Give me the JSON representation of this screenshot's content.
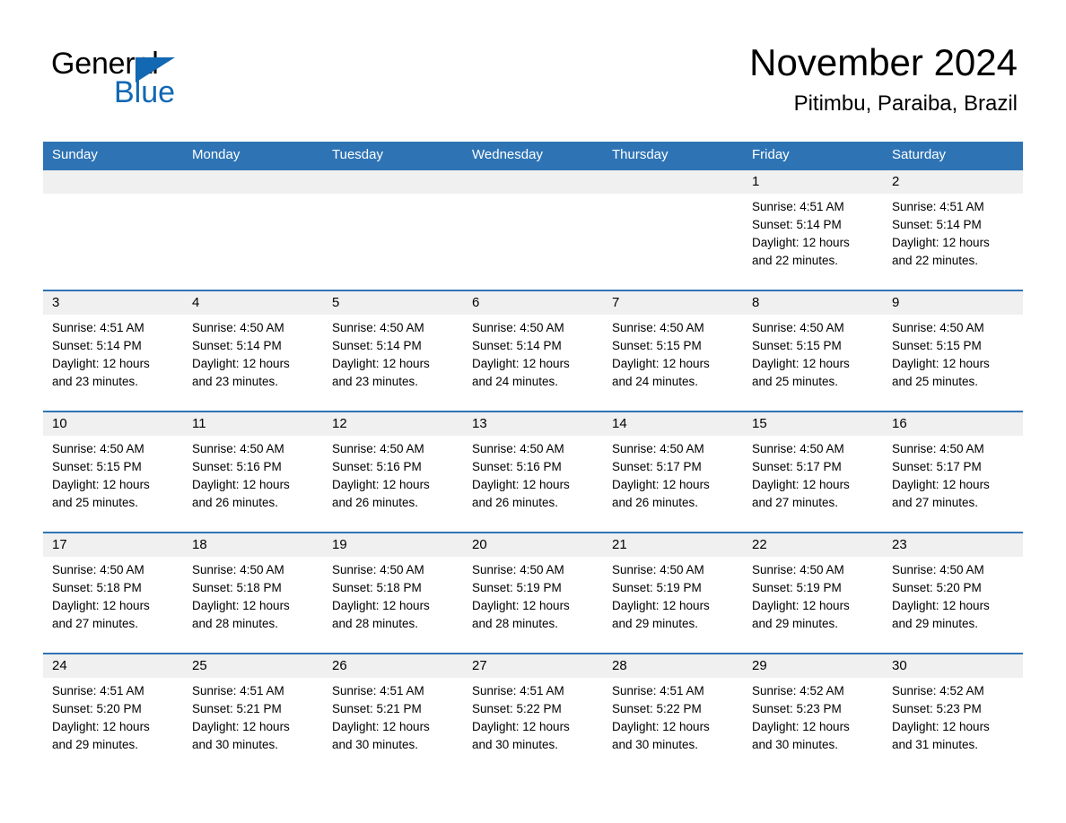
{
  "brand": {
    "name_part1": "General",
    "name_part2": "Blue",
    "accent_color": "#1268b3"
  },
  "header": {
    "month_title": "November 2024",
    "location": "Pitimbu, Paraiba, Brazil",
    "header_bar_color": "#2e74b5",
    "daynum_band_color": "#f0f0f0"
  },
  "weekdays": [
    "Sunday",
    "Monday",
    "Tuesday",
    "Wednesday",
    "Thursday",
    "Friday",
    "Saturday"
  ],
  "weeks": [
    [
      {
        "day": "",
        "sunrise": "",
        "sunset": "",
        "daylight_line1": "",
        "daylight_line2": "",
        "empty": true
      },
      {
        "day": "",
        "sunrise": "",
        "sunset": "",
        "daylight_line1": "",
        "daylight_line2": "",
        "empty": true
      },
      {
        "day": "",
        "sunrise": "",
        "sunset": "",
        "daylight_line1": "",
        "daylight_line2": "",
        "empty": true
      },
      {
        "day": "",
        "sunrise": "",
        "sunset": "",
        "daylight_line1": "",
        "daylight_line2": "",
        "empty": true
      },
      {
        "day": "",
        "sunrise": "",
        "sunset": "",
        "daylight_line1": "",
        "daylight_line2": "",
        "empty": true
      },
      {
        "day": "1",
        "sunrise": "Sunrise: 4:51 AM",
        "sunset": "Sunset: 5:14 PM",
        "daylight_line1": "Daylight: 12 hours",
        "daylight_line2": "and 22 minutes.",
        "empty": false
      },
      {
        "day": "2",
        "sunrise": "Sunrise: 4:51 AM",
        "sunset": "Sunset: 5:14 PM",
        "daylight_line1": "Daylight: 12 hours",
        "daylight_line2": "and 22 minutes.",
        "empty": false
      }
    ],
    [
      {
        "day": "3",
        "sunrise": "Sunrise: 4:51 AM",
        "sunset": "Sunset: 5:14 PM",
        "daylight_line1": "Daylight: 12 hours",
        "daylight_line2": "and 23 minutes.",
        "empty": false
      },
      {
        "day": "4",
        "sunrise": "Sunrise: 4:50 AM",
        "sunset": "Sunset: 5:14 PM",
        "daylight_line1": "Daylight: 12 hours",
        "daylight_line2": "and 23 minutes.",
        "empty": false
      },
      {
        "day": "5",
        "sunrise": "Sunrise: 4:50 AM",
        "sunset": "Sunset: 5:14 PM",
        "daylight_line1": "Daylight: 12 hours",
        "daylight_line2": "and 23 minutes.",
        "empty": false
      },
      {
        "day": "6",
        "sunrise": "Sunrise: 4:50 AM",
        "sunset": "Sunset: 5:14 PM",
        "daylight_line1": "Daylight: 12 hours",
        "daylight_line2": "and 24 minutes.",
        "empty": false
      },
      {
        "day": "7",
        "sunrise": "Sunrise: 4:50 AM",
        "sunset": "Sunset: 5:15 PM",
        "daylight_line1": "Daylight: 12 hours",
        "daylight_line2": "and 24 minutes.",
        "empty": false
      },
      {
        "day": "8",
        "sunrise": "Sunrise: 4:50 AM",
        "sunset": "Sunset: 5:15 PM",
        "daylight_line1": "Daylight: 12 hours",
        "daylight_line2": "and 25 minutes.",
        "empty": false
      },
      {
        "day": "9",
        "sunrise": "Sunrise: 4:50 AM",
        "sunset": "Sunset: 5:15 PM",
        "daylight_line1": "Daylight: 12 hours",
        "daylight_line2": "and 25 minutes.",
        "empty": false
      }
    ],
    [
      {
        "day": "10",
        "sunrise": "Sunrise: 4:50 AM",
        "sunset": "Sunset: 5:15 PM",
        "daylight_line1": "Daylight: 12 hours",
        "daylight_line2": "and 25 minutes.",
        "empty": false
      },
      {
        "day": "11",
        "sunrise": "Sunrise: 4:50 AM",
        "sunset": "Sunset: 5:16 PM",
        "daylight_line1": "Daylight: 12 hours",
        "daylight_line2": "and 26 minutes.",
        "empty": false
      },
      {
        "day": "12",
        "sunrise": "Sunrise: 4:50 AM",
        "sunset": "Sunset: 5:16 PM",
        "daylight_line1": "Daylight: 12 hours",
        "daylight_line2": "and 26 minutes.",
        "empty": false
      },
      {
        "day": "13",
        "sunrise": "Sunrise: 4:50 AM",
        "sunset": "Sunset: 5:16 PM",
        "daylight_line1": "Daylight: 12 hours",
        "daylight_line2": "and 26 minutes.",
        "empty": false
      },
      {
        "day": "14",
        "sunrise": "Sunrise: 4:50 AM",
        "sunset": "Sunset: 5:17 PM",
        "daylight_line1": "Daylight: 12 hours",
        "daylight_line2": "and 26 minutes.",
        "empty": false
      },
      {
        "day": "15",
        "sunrise": "Sunrise: 4:50 AM",
        "sunset": "Sunset: 5:17 PM",
        "daylight_line1": "Daylight: 12 hours",
        "daylight_line2": "and 27 minutes.",
        "empty": false
      },
      {
        "day": "16",
        "sunrise": "Sunrise: 4:50 AM",
        "sunset": "Sunset: 5:17 PM",
        "daylight_line1": "Daylight: 12 hours",
        "daylight_line2": "and 27 minutes.",
        "empty": false
      }
    ],
    [
      {
        "day": "17",
        "sunrise": "Sunrise: 4:50 AM",
        "sunset": "Sunset: 5:18 PM",
        "daylight_line1": "Daylight: 12 hours",
        "daylight_line2": "and 27 minutes.",
        "empty": false
      },
      {
        "day": "18",
        "sunrise": "Sunrise: 4:50 AM",
        "sunset": "Sunset: 5:18 PM",
        "daylight_line1": "Daylight: 12 hours",
        "daylight_line2": "and 28 minutes.",
        "empty": false
      },
      {
        "day": "19",
        "sunrise": "Sunrise: 4:50 AM",
        "sunset": "Sunset: 5:18 PM",
        "daylight_line1": "Daylight: 12 hours",
        "daylight_line2": "and 28 minutes.",
        "empty": false
      },
      {
        "day": "20",
        "sunrise": "Sunrise: 4:50 AM",
        "sunset": "Sunset: 5:19 PM",
        "daylight_line1": "Daylight: 12 hours",
        "daylight_line2": "and 28 minutes.",
        "empty": false
      },
      {
        "day": "21",
        "sunrise": "Sunrise: 4:50 AM",
        "sunset": "Sunset: 5:19 PM",
        "daylight_line1": "Daylight: 12 hours",
        "daylight_line2": "and 29 minutes.",
        "empty": false
      },
      {
        "day": "22",
        "sunrise": "Sunrise: 4:50 AM",
        "sunset": "Sunset: 5:19 PM",
        "daylight_line1": "Daylight: 12 hours",
        "daylight_line2": "and 29 minutes.",
        "empty": false
      },
      {
        "day": "23",
        "sunrise": "Sunrise: 4:50 AM",
        "sunset": "Sunset: 5:20 PM",
        "daylight_line1": "Daylight: 12 hours",
        "daylight_line2": "and 29 minutes.",
        "empty": false
      }
    ],
    [
      {
        "day": "24",
        "sunrise": "Sunrise: 4:51 AM",
        "sunset": "Sunset: 5:20 PM",
        "daylight_line1": "Daylight: 12 hours",
        "daylight_line2": "and 29 minutes.",
        "empty": false
      },
      {
        "day": "25",
        "sunrise": "Sunrise: 4:51 AM",
        "sunset": "Sunset: 5:21 PM",
        "daylight_line1": "Daylight: 12 hours",
        "daylight_line2": "and 30 minutes.",
        "empty": false
      },
      {
        "day": "26",
        "sunrise": "Sunrise: 4:51 AM",
        "sunset": "Sunset: 5:21 PM",
        "daylight_line1": "Daylight: 12 hours",
        "daylight_line2": "and 30 minutes.",
        "empty": false
      },
      {
        "day": "27",
        "sunrise": "Sunrise: 4:51 AM",
        "sunset": "Sunset: 5:22 PM",
        "daylight_line1": "Daylight: 12 hours",
        "daylight_line2": "and 30 minutes.",
        "empty": false
      },
      {
        "day": "28",
        "sunrise": "Sunrise: 4:51 AM",
        "sunset": "Sunset: 5:22 PM",
        "daylight_line1": "Daylight: 12 hours",
        "daylight_line2": "and 30 minutes.",
        "empty": false
      },
      {
        "day": "29",
        "sunrise": "Sunrise: 4:52 AM",
        "sunset": "Sunset: 5:23 PM",
        "daylight_line1": "Daylight: 12 hours",
        "daylight_line2": "and 30 minutes.",
        "empty": false
      },
      {
        "day": "30",
        "sunrise": "Sunrise: 4:52 AM",
        "sunset": "Sunset: 5:23 PM",
        "daylight_line1": "Daylight: 12 hours",
        "daylight_line2": "and 31 minutes.",
        "empty": false
      }
    ]
  ]
}
